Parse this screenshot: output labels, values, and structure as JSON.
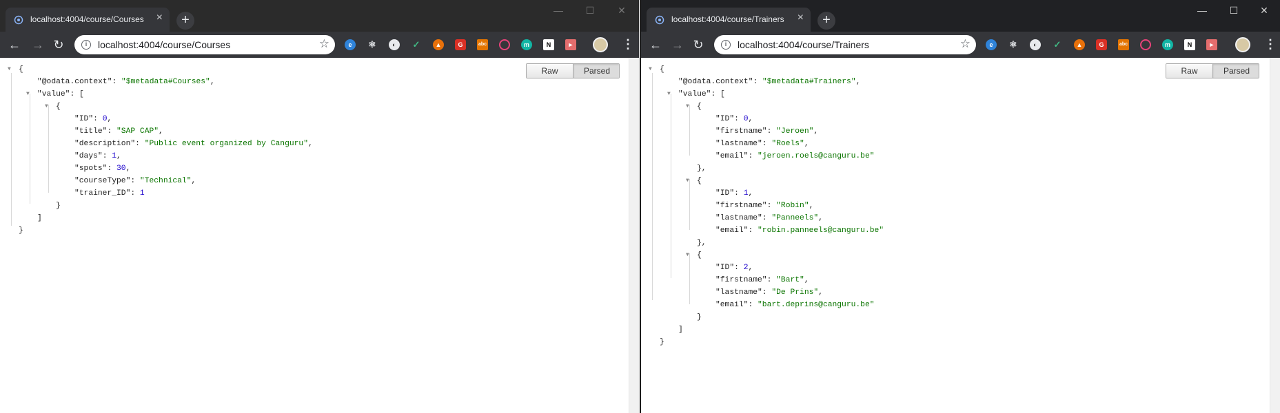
{
  "left": {
    "tab_title": "localhost:4004/course/Courses",
    "url": "localhost:4004/course/Courses",
    "toggle": {
      "raw": "Raw",
      "parsed": "Parsed"
    },
    "json": {
      "l1": "{",
      "l2_key": "\"@odata.context\"",
      "l2_val": "\"$metadata#Courses\"",
      "l3_key": "\"value\"",
      "l3_open": "[",
      "l4": "{",
      "l5_key": "\"ID\"",
      "l5_val": "0",
      "l6_key": "\"title\"",
      "l6_val": "\"SAP CAP\"",
      "l7_key": "\"description\"",
      "l7_val": "\"Public event organized by Canguru\"",
      "l8_key": "\"days\"",
      "l8_val": "1",
      "l9_key": "\"spots\"",
      "l9_val": "30",
      "l10_key": "\"courseType\"",
      "l10_val": "\"Technical\"",
      "l11_key": "\"trainer_ID\"",
      "l11_val": "1",
      "l12": "}",
      "l13": "]",
      "l14": "}"
    }
  },
  "right": {
    "tab_title": "localhost:4004/course/Trainers",
    "url": "localhost:4004/course/Trainers",
    "toggle": {
      "raw": "Raw",
      "parsed": "Parsed"
    },
    "json": {
      "l1": "{",
      "l2_key": "\"@odata.context\"",
      "l2_val": "\"$metadata#Trainers\"",
      "l3_key": "\"value\"",
      "l3_open": "[",
      "trainers": [
        {
          "id": "0",
          "firstname": "\"Jeroen\"",
          "lastname": "\"Roels\"",
          "email": "\"jeroen.roels@canguru.be\""
        },
        {
          "id": "1",
          "firstname": "\"Robin\"",
          "lastname": "\"Panneels\"",
          "email": "\"robin.panneels@canguru.be\""
        },
        {
          "id": "2",
          "firstname": "\"Bart\"",
          "lastname": "\"De Prins\"",
          "email": "\"bart.deprins@canguru.be\""
        }
      ],
      "k_id": "\"ID\"",
      "k_first": "\"firstname\"",
      "k_last": "\"lastname\"",
      "k_email": "\"email\"",
      "close_arr": "]",
      "close_root": "}"
    }
  },
  "window_controls": {
    "minimize": "—",
    "maximize": "☐",
    "close": "✕"
  },
  "colors": {
    "string": "#0b7500",
    "number": "#1a01cc",
    "titlebar": "#202124",
    "toolbar": "#35363a"
  },
  "extensions": [
    "edge-icon",
    "react-devtools-icon",
    "ublock-icon",
    "vue-icon",
    "lighthouse-icon",
    "shield-icon",
    "ad-icon",
    "record-icon",
    "m-icon",
    "notion-icon",
    "arrow-icon"
  ]
}
